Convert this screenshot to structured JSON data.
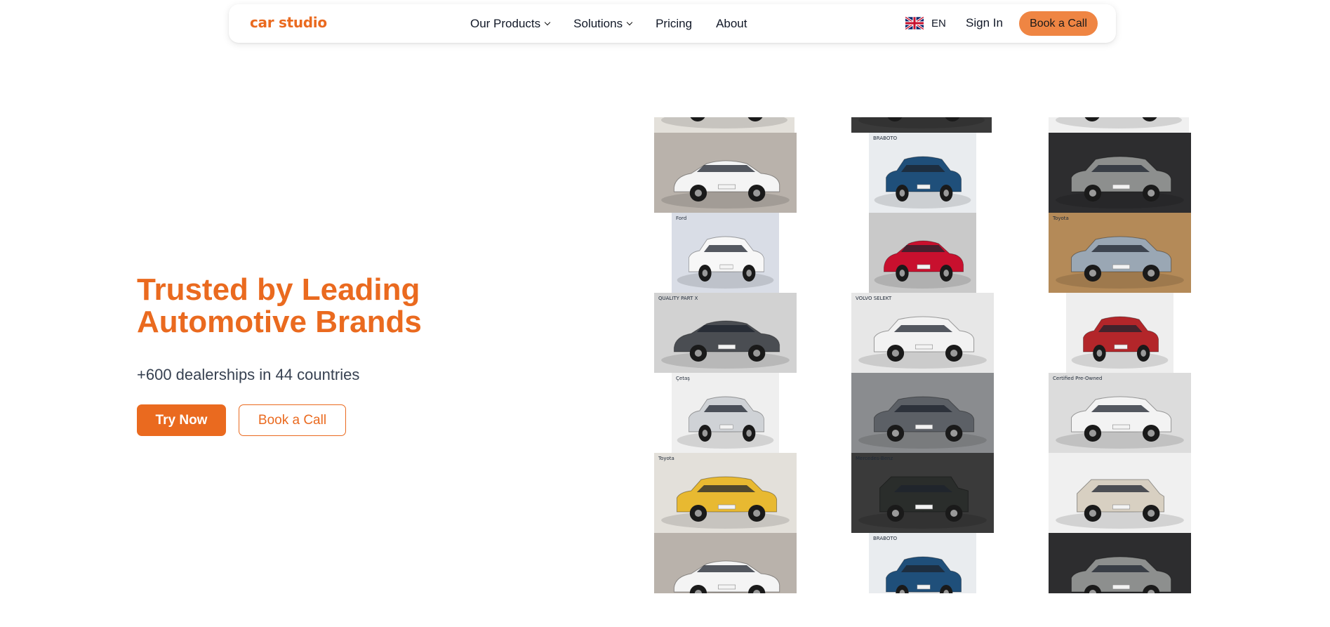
{
  "nav": {
    "logo": "car studio",
    "links": [
      {
        "label": "Our Products",
        "dropdown": true
      },
      {
        "label": "Solutions",
        "dropdown": true
      },
      {
        "label": "Pricing",
        "dropdown": false
      },
      {
        "label": "About",
        "dropdown": false
      }
    ],
    "language": "EN",
    "sign_in": "Sign In",
    "cta": "Book a Call"
  },
  "hero": {
    "title_line1": "Trusted by Leading",
    "title_line2": "Automotive Brands",
    "subtitle": "+600 dealerships in 44 countries",
    "primary_button": "Try Now",
    "secondary_button": "Book a Call"
  },
  "colors": {
    "accent": "#ea6a1f",
    "nav_cta_bg": "#ef8543"
  },
  "car_grid": [
    {
      "column": 1,
      "tiles": [
        {
          "car": "white sedan",
          "body_color": "#f4f4f4",
          "bg": "#b9b2ab",
          "label": "",
          "narrow": false
        },
        {
          "car": "white compact SUV",
          "body_color": "#f7f7f7",
          "bg": "#d9dde6",
          "label": "Ford",
          "narrow": true
        },
        {
          "car": "grey sedan",
          "body_color": "#4a4d52",
          "bg": "#d2d2d2",
          "label": "QUALITY PART X",
          "narrow": false
        },
        {
          "car": "silver SUV",
          "body_color": "#cfd2d6",
          "bg": "#efefef",
          "label": "Çetaş",
          "narrow": true
        },
        {
          "car": "yellow crossover",
          "body_color": "#e8b931",
          "bg": "#e3e0da",
          "label": "Toyota",
          "narrow": false
        },
        {
          "car": "white sedan",
          "body_color": "#f4f4f4",
          "bg": "#b9b2ab",
          "label": "",
          "narrow": false
        }
      ]
    },
    {
      "column": 2,
      "tiles": [
        {
          "car": "blue SUV",
          "body_color": "#1f4f7a",
          "bg": "#e9ecef",
          "label": "BRABOTO",
          "narrow": true
        },
        {
          "car": "red sports car",
          "body_color": "#c8102e",
          "bg": "#c9c9c9",
          "label": "",
          "narrow": true
        },
        {
          "car": "white SUV",
          "body_color": "#f2f2f2",
          "bg": "#e7e7e7",
          "label": "VOLVO SELEKT",
          "narrow": false
        },
        {
          "car": "grey SUV",
          "body_color": "#5c6066",
          "bg": "#8a8c8f",
          "label": "",
          "narrow": false
        },
        {
          "car": "black off-roader",
          "body_color": "#2a2d2b",
          "bg": "#3a3a3a",
          "label": "Mercedes-Benz",
          "narrow": false
        },
        {
          "car": "blue SUV",
          "body_color": "#1f4f7a",
          "bg": "#e9ecef",
          "label": "BRABOTO",
          "narrow": true
        }
      ]
    },
    {
      "column": 3,
      "tiles": [
        {
          "car": "grey crossover",
          "body_color": "#8d8f8e",
          "bg": "#2d2d2f",
          "label": "",
          "narrow": false
        },
        {
          "car": "blue-grey SUV",
          "body_color": "#9aa7b4",
          "bg": "#b48a58",
          "label": "Toyota",
          "narrow": false
        },
        {
          "car": "red SUV",
          "body_color": "#b3262a",
          "bg": "#eeeeee",
          "label": "",
          "narrow": true
        },
        {
          "car": "white SUV",
          "body_color": "#f3f3f3",
          "bg": "#dcdcdc",
          "label": "Certified Pre-Owned",
          "narrow": false
        },
        {
          "car": "beige mini",
          "body_color": "#d8d0c2",
          "bg": "#f0f0f0",
          "label": "",
          "narrow": false
        },
        {
          "car": "grey crossover",
          "body_color": "#8d8f8e",
          "bg": "#2d2d2f",
          "label": "",
          "narrow": false
        }
      ]
    }
  ]
}
